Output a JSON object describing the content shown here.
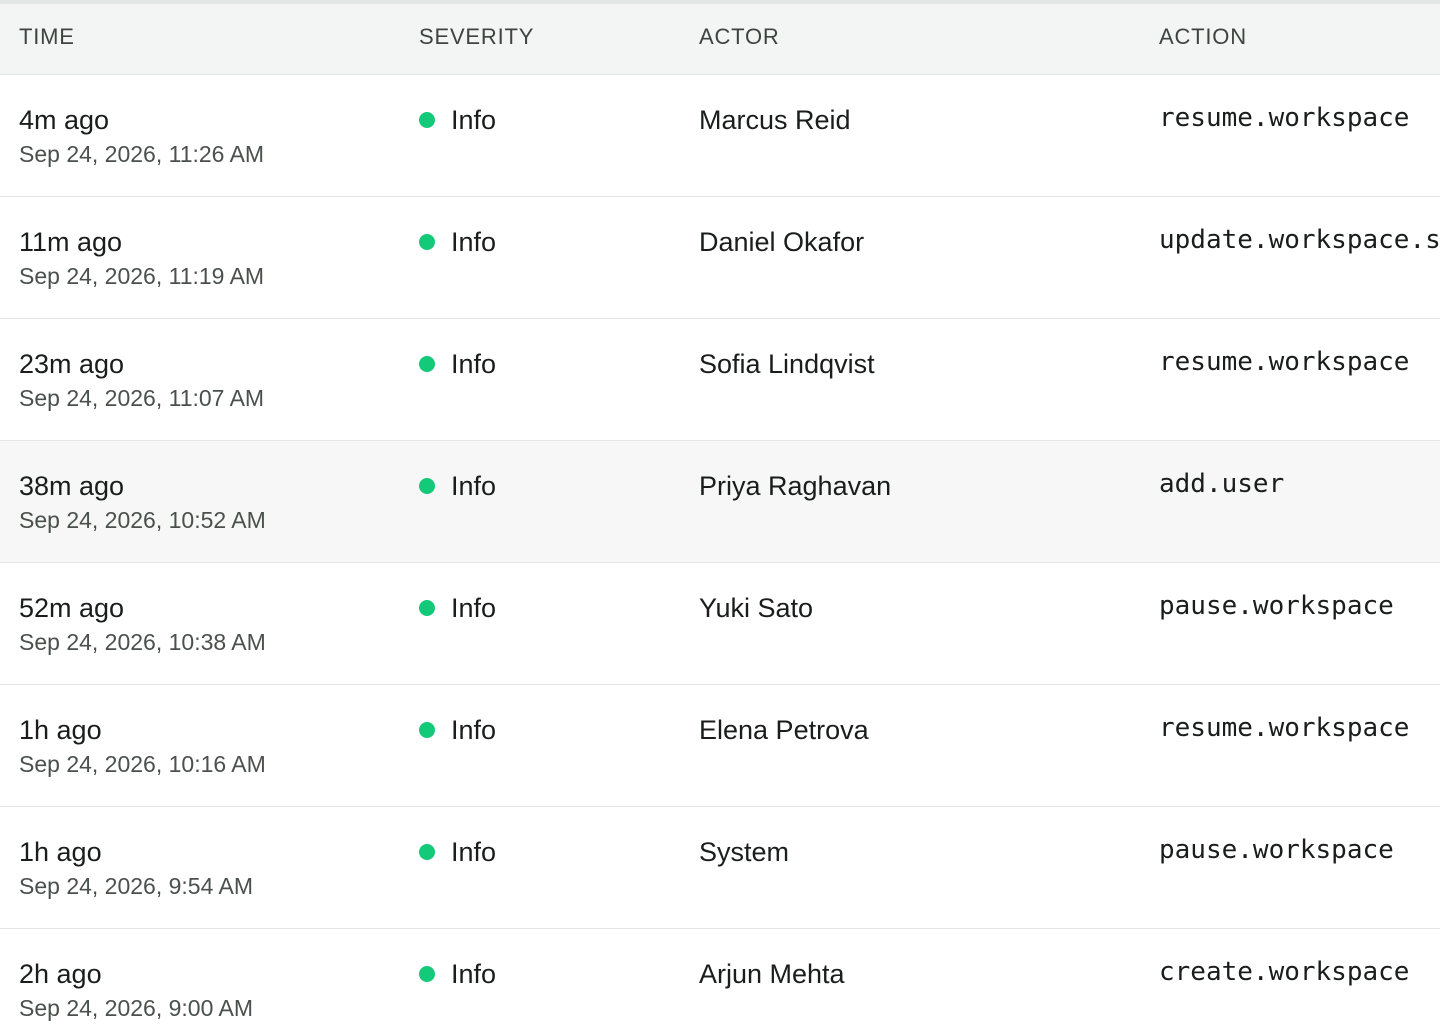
{
  "table": {
    "headers": {
      "time": "TIME",
      "severity": "SEVERITY",
      "actor": "ACTOR",
      "action": "ACTION"
    },
    "rows": [
      {
        "relative_time": "4m ago",
        "timestamp": "Sep 24, 2026, 11:26 AM",
        "severity": "Info",
        "actor": "Marcus Reid",
        "action": "resume.workspace"
      },
      {
        "relative_time": "11m ago",
        "timestamp": "Sep 24, 2026, 11:19 AM",
        "severity": "Info",
        "actor": "Daniel Okafor",
        "action": "update.workspace.settings"
      },
      {
        "relative_time": "23m ago",
        "timestamp": "Sep 24, 2026, 11:07 AM",
        "severity": "Info",
        "actor": "Sofia Lindqvist",
        "action": "resume.workspace"
      },
      {
        "relative_time": "38m ago",
        "timestamp": "Sep 24, 2026, 10:52 AM",
        "severity": "Info",
        "actor": "Priya Raghavan",
        "action": "add.user"
      },
      {
        "relative_time": "52m ago",
        "timestamp": "Sep 24, 2026, 10:38 AM",
        "severity": "Info",
        "actor": "Yuki Sato",
        "action": "pause.workspace"
      },
      {
        "relative_time": "1h ago",
        "timestamp": "Sep 24, 2026, 10:16 AM",
        "severity": "Info",
        "actor": "Elena Petrova",
        "action": "resume.workspace"
      },
      {
        "relative_time": "1h ago",
        "timestamp": "Sep 24, 2026, 9:54 AM",
        "severity": "Info",
        "actor": "System",
        "action": "pause.workspace"
      },
      {
        "relative_time": "2h ago",
        "timestamp": "Sep 24, 2026, 9:00 AM",
        "severity": "Info",
        "actor": "Arjun Mehta",
        "action": "create.workspace"
      }
    ]
  },
  "colors": {
    "severity_info": "#14c97a",
    "header_background": "#f3f5f4",
    "hover_row_background": "#f6f7f6"
  },
  "icons": {
    "severity_info": "status-dot-icon"
  }
}
